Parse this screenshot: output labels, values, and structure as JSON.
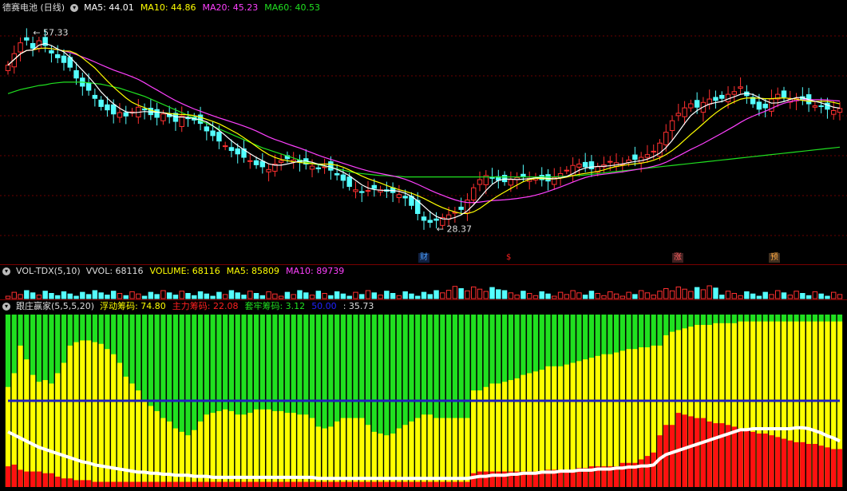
{
  "price_panel": {
    "title": "德赛电池 (日线)",
    "ma": [
      {
        "label": "MA5:",
        "value": "44.01",
        "color": "#ffffff"
      },
      {
        "label": "MA10:",
        "value": "44.86",
        "color": "#ffff00"
      },
      {
        "label": "MA20:",
        "value": "45.23",
        "color": "#ff40ff"
      },
      {
        "label": "MA60:",
        "value": "40.53",
        "color": "#20e020"
      }
    ],
    "high_label": "57.33",
    "low_label": "28.37",
    "events": [
      {
        "text": "财",
        "color": "#4aa0ff"
      },
      {
        "text": "$",
        "color": "#ff2020"
      },
      {
        "text": "涨",
        "color": "#ff6060"
      },
      {
        "text": "预",
        "color": "#ffaa40"
      }
    ]
  },
  "volume_panel": {
    "title": "VOL-TDX(5,10)",
    "items": [
      {
        "label": "VVOL:",
        "value": "68116",
        "color": "#dddddd"
      },
      {
        "label": "VOLUME:",
        "value": "68116",
        "color": "#ffff00"
      },
      {
        "label": "MA5:",
        "value": "85809",
        "color": "#ffff00"
      },
      {
        "label": "MA10:",
        "value": "89739",
        "color": "#ff40ff"
      }
    ]
  },
  "chip_panel": {
    "title": "跟庄赢家(5,5,5,20)",
    "items": [
      {
        "label": "浮动筹码:",
        "value": "74.80",
        "color": "#ffff00"
      },
      {
        "label": "主力筹码:",
        "value": "22.08",
        "color": "#ff2020"
      },
      {
        "label": "套牢筹码:",
        "value": "3.12",
        "color": "#20e020"
      },
      {
        "label": "50.00",
        "value": "",
        "color": "#2020ff"
      },
      {
        "label": ":",
        "value": "35.73",
        "color": "#dddddd"
      }
    ]
  },
  "chart_data": {
    "type": "candlestick",
    "price_range": [
      25,
      60
    ],
    "closes": [
      52.5,
      54.2,
      55.8,
      56.2,
      55.0,
      56.1,
      55.4,
      54.3,
      53.6,
      52.9,
      52.2,
      50.6,
      49.4,
      48.8,
      47.6,
      46.4,
      45.9,
      45.3,
      45.5,
      45.0,
      45.6,
      46.3,
      45.9,
      45.2,
      44.8,
      45.3,
      44.9,
      44.2,
      45.0,
      44.6,
      44.4,
      43.9,
      42.8,
      42.1,
      41.3,
      40.6,
      39.9,
      39.4,
      38.9,
      38.4,
      37.8,
      37.5,
      37.1,
      37.9,
      38.4,
      38.7,
      38.5,
      38.2,
      37.9,
      37.6,
      37.2,
      37.5,
      37.0,
      36.3,
      35.5,
      34.6,
      34.1,
      33.7,
      34.0,
      34.3,
      34.1,
      33.9,
      33.7,
      33.4,
      32.9,
      31.8,
      30.6,
      29.6,
      29.3,
      29.6,
      30.0,
      30.4,
      30.8,
      31.2,
      32.6,
      34.4,
      35.6,
      36.2,
      35.8,
      35.5,
      35.3,
      35.6,
      35.9,
      36.1,
      35.8,
      36.0,
      35.6,
      35.4,
      35.9,
      36.5,
      37.0,
      37.7,
      37.9,
      37.5,
      37.2,
      37.5,
      37.8,
      38.3,
      38.1,
      37.9,
      38.5,
      38.6,
      38.9,
      39.3,
      39.8,
      41.0,
      42.6,
      44.3,
      45.4,
      46.2,
      46.8,
      46.3,
      47.0,
      47.5,
      47.3,
      47.6,
      48.2,
      48.6,
      49.3,
      48.0,
      46.8,
      46.0,
      46.2,
      47.5,
      48.2,
      47.8,
      47.5,
      47.6,
      47.4,
      46.8,
      46.5,
      46.4,
      46.0,
      45.8,
      46.1
    ],
    "ma60": [
      48.3,
      48.6,
      48.9,
      49.1,
      49.3,
      49.5,
      49.6,
      49.8,
      49.9,
      50.0,
      50.0,
      50.0,
      50.0,
      49.9,
      49.8,
      49.7,
      49.5,
      49.3,
      49.1,
      48.8,
      48.5,
      48.2,
      47.9,
      47.5,
      47.1,
      46.7,
      46.3,
      45.9,
      45.5,
      45.1,
      44.7,
      44.3,
      43.9,
      43.5,
      43.1,
      42.7,
      42.3,
      41.9,
      41.5,
      41.1,
      40.7,
      40.3,
      40.0,
      39.7,
      39.4,
      39.1,
      38.8,
      38.5,
      38.2,
      38.0,
      37.8,
      37.6,
      37.4,
      37.2,
      37.0,
      36.8,
      36.6,
      36.5,
      36.4,
      36.3,
      36.2,
      36.2,
      36.1,
      36.1,
      36.0,
      36.0,
      36.0,
      36.0,
      36.0,
      36.0,
      36.0,
      36.0,
      36.0,
      36.0,
      36.0,
      36.0,
      36.0,
      36.0,
      36.0,
      36.0,
      36.0,
      36.0,
      36.0,
      36.0,
      36.0,
      36.0,
      36.0,
      36.0,
      36.0,
      36.1,
      36.1,
      36.2,
      36.2,
      36.3,
      36.4,
      36.5,
      36.6,
      36.7,
      36.8,
      36.9,
      37.0,
      37.1,
      37.2,
      37.3,
      37.4,
      37.5,
      37.6,
      37.7,
      37.8,
      37.9,
      38.0,
      38.1,
      38.2,
      38.3,
      38.4,
      38.5,
      38.6,
      38.7,
      38.8,
      38.9,
      39.0,
      39.1,
      39.2,
      39.3,
      39.4,
      39.5,
      39.6,
      39.7,
      39.8,
      39.9,
      40.0,
      40.1,
      40.2,
      40.3,
      40.4
    ],
    "chip_red": [
      12,
      13,
      10,
      9,
      9,
      9,
      8,
      8,
      6,
      5,
      5,
      4,
      4,
      4,
      3,
      3,
      3,
      3,
      3,
      3,
      3,
      3,
      3,
      3,
      3,
      3,
      3,
      3,
      3,
      3,
      3,
      3,
      3,
      3,
      3,
      3,
      3,
      3,
      3,
      3,
      3,
      3,
      3,
      3,
      3,
      3,
      3,
      3,
      3,
      3,
      3,
      3,
      3,
      3,
      3,
      3,
      3,
      3,
      3,
      3,
      3,
      3,
      3,
      3,
      3,
      3,
      3,
      3,
      3,
      3,
      3,
      3,
      3,
      3,
      3,
      8,
      9,
      9,
      9,
      9,
      9,
      9,
      9,
      9,
      9,
      9,
      9,
      10,
      10,
      10,
      10,
      10,
      11,
      11,
      12,
      12,
      12,
      12,
      12,
      14,
      14,
      14,
      16,
      18,
      20,
      30,
      36,
      36,
      43,
      42,
      41,
      40,
      40,
      38,
      37,
      37,
      36,
      35,
      34,
      33,
      32,
      31,
      31,
      30,
      29,
      28,
      27,
      26,
      26,
      25,
      25,
      24,
      23,
      22,
      22
    ],
    "chip_yellow_top": [
      58,
      66,
      82,
      74,
      65,
      61,
      62,
      60,
      66,
      72,
      82,
      84,
      85,
      85,
      84,
      83,
      80,
      77,
      72,
      64,
      60,
      56,
      50,
      47,
      44,
      40,
      38,
      34,
      32,
      30,
      33,
      38,
      42,
      43,
      44,
      45,
      44,
      42,
      42,
      43,
      45,
      45,
      45,
      44,
      44,
      43,
      43,
      42,
      42,
      40,
      35,
      34,
      35,
      38,
      40,
      40,
      40,
      40,
      36,
      32,
      31,
      30,
      31,
      34,
      36,
      38,
      40,
      42,
      42,
      40,
      40,
      40,
      40,
      40,
      40,
      56,
      56,
      58,
      60,
      60,
      61,
      62,
      63,
      65,
      66,
      67,
      68,
      70,
      70,
      70,
      71,
      72,
      73,
      74,
      75,
      76,
      77,
      77,
      78,
      79,
      80,
      80,
      81,
      81,
      82,
      82,
      88,
      90,
      91,
      92,
      93,
      94,
      94,
      94,
      95,
      95,
      95,
      95,
      96,
      96,
      96,
      96,
      96,
      96,
      96,
      96,
      96,
      96,
      96,
      96,
      96,
      96,
      96,
      96,
      96
    ],
    "chip_white": [
      50,
      47,
      44,
      41,
      38,
      35,
      33,
      31,
      29,
      27,
      25,
      23,
      21,
      20,
      18,
      17,
      16,
      15,
      14,
      13,
      12,
      11,
      11,
      10,
      10,
      9,
      9,
      8,
      8,
      8,
      7,
      7,
      7,
      6,
      6,
      6,
      6,
      6,
      6,
      6,
      6,
      6,
      6,
      6,
      6,
      6,
      6,
      6,
      6,
      6,
      5,
      5,
      5,
      5,
      5,
      5,
      5,
      5,
      5,
      5,
      5,
      5,
      5,
      5,
      5,
      5,
      5,
      5,
      5,
      5,
      5,
      5,
      5,
      5,
      5,
      6,
      7,
      7,
      8,
      8,
      8,
      9,
      9,
      10,
      10,
      10,
      11,
      11,
      11,
      12,
      12,
      12,
      13,
      13,
      13,
      14,
      14,
      14,
      15,
      15,
      16,
      16,
      17,
      17,
      18,
      24,
      28,
      30,
      32,
      34,
      36,
      38,
      40,
      42,
      44,
      46,
      48,
      50,
      52,
      52,
      53,
      53,
      53,
      53,
      53,
      53,
      53,
      54,
      54,
      53,
      51,
      49,
      46,
      44,
      41
    ]
  }
}
